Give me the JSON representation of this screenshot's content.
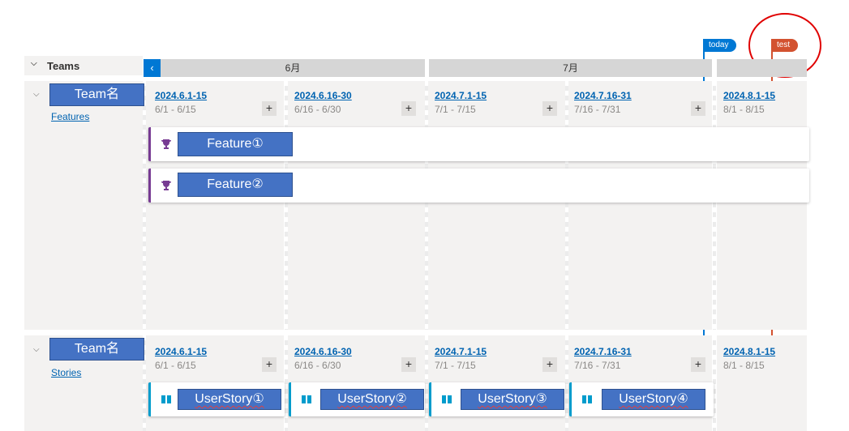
{
  "header": {
    "teams_label": "Teams",
    "nav_prev": "‹",
    "months": [
      "6月",
      "7月"
    ]
  },
  "markers": {
    "today": {
      "label": "today",
      "color": "#0078d4"
    },
    "test": {
      "label": "test",
      "color": "#d35230"
    }
  },
  "teams": [
    {
      "name": "Team名",
      "sub_link": "Features",
      "iterations": [
        {
          "name": "2024.6.1-15",
          "range": "6/1 - 6/15",
          "add": "+"
        },
        {
          "name": "2024.6.16-30",
          "range": "6/16 - 6/30",
          "add": "+"
        },
        {
          "name": "2024.7.1-15",
          "range": "7/1 - 7/15",
          "add": "+"
        },
        {
          "name": "2024.7.16-31",
          "range": "7/16 - 7/31",
          "add": "+"
        },
        {
          "name": "2024.8.1-15",
          "range": "8/1 - 8/15"
        }
      ],
      "items": [
        {
          "label": "Feature①",
          "icon": "trophy-icon"
        },
        {
          "label": "Feature②",
          "icon": "trophy-icon"
        }
      ]
    },
    {
      "name": "Team名",
      "sub_link": "Stories",
      "iterations": [
        {
          "name": "2024.6.1-15",
          "range": "6/1 - 6/15",
          "add": "+"
        },
        {
          "name": "2024.6.16-30",
          "range": "6/16 - 6/30",
          "add": "+"
        },
        {
          "name": "2024.7.1-15",
          "range": "7/1 - 7/15",
          "add": "+"
        },
        {
          "name": "2024.7.16-31",
          "range": "7/16 - 7/31",
          "add": "+"
        },
        {
          "name": "2024.8.1-15",
          "range": "8/1 - 8/15"
        }
      ],
      "items": [
        {
          "label": "UserStory①",
          "icon": "book-icon"
        },
        {
          "label": "UserStory②",
          "icon": "book-icon"
        },
        {
          "label": "UserStory③",
          "icon": "book-icon"
        },
        {
          "label": "UserStory④",
          "icon": "book-icon"
        }
      ]
    }
  ],
  "colors": {
    "accent": "#0078d4",
    "feature": "#773b93",
    "story": "#009ccc",
    "highlight_box": "#4472c4",
    "annotation_circle": "#e00000"
  }
}
